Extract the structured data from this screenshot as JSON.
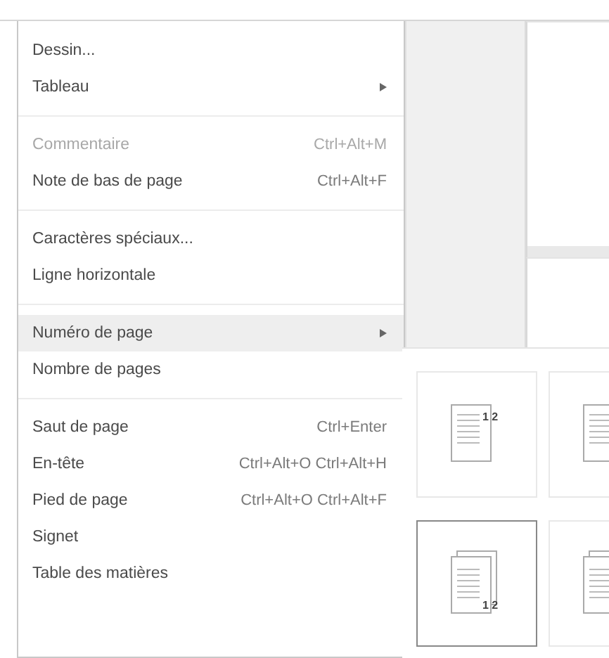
{
  "menu": {
    "sections": [
      [
        {
          "label": "Dessin...",
          "kind": "action",
          "disabled": false,
          "selected": false
        },
        {
          "label": "Tableau",
          "kind": "submenu",
          "disabled": false,
          "selected": false
        }
      ],
      [
        {
          "label": "Commentaire",
          "shortcut": "Ctrl+Alt+M",
          "kind": "action",
          "disabled": true,
          "selected": false
        },
        {
          "label": "Note de bas de page",
          "shortcut": "Ctrl+Alt+F",
          "kind": "action",
          "disabled": false,
          "selected": false
        }
      ],
      [
        {
          "label": "Caractères spéciaux...",
          "kind": "action",
          "disabled": false,
          "selected": false
        },
        {
          "label": "Ligne horizontale",
          "kind": "action",
          "disabled": false,
          "selected": false
        }
      ],
      [
        {
          "label": "Numéro de page",
          "kind": "submenu",
          "disabled": false,
          "selected": true
        },
        {
          "label": "Nombre de pages",
          "kind": "action",
          "disabled": false,
          "selected": false
        }
      ],
      [
        {
          "label": "Saut de page",
          "shortcut": "Ctrl+Enter",
          "kind": "action",
          "disabled": false,
          "selected": false
        },
        {
          "label": "En-tête",
          "shortcut": "Ctrl+Alt+O Ctrl+Alt+H",
          "kind": "action",
          "disabled": false,
          "selected": false
        },
        {
          "label": "Pied de page",
          "shortcut": "Ctrl+Alt+O Ctrl+Alt+F",
          "kind": "action",
          "disabled": false,
          "selected": false
        },
        {
          "label": "Signet",
          "kind": "action",
          "disabled": false,
          "selected": false
        },
        {
          "label": "Table des matières",
          "kind": "action",
          "disabled": false,
          "selected": false
        }
      ]
    ]
  },
  "submenu": {
    "options": [
      {
        "kind": "top",
        "marks": "1 2",
        "selected": false
      },
      {
        "kind": "top-cut",
        "selected": false
      },
      {
        "kind": "bottom",
        "marks": "1 2",
        "selected": true
      },
      {
        "kind": "bottom-cut",
        "selected": false
      }
    ]
  }
}
